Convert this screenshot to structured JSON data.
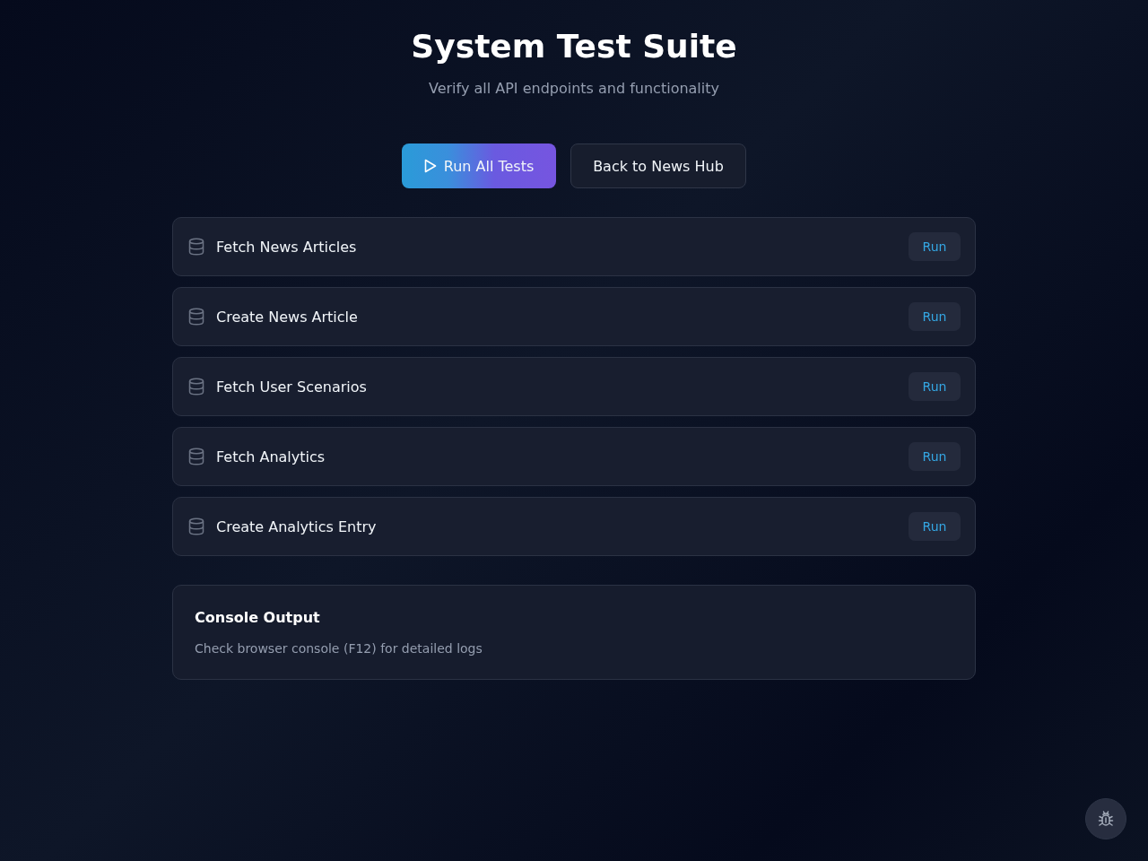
{
  "header": {
    "title": "System Test Suite",
    "subtitle": "Verify all API endpoints and functionality"
  },
  "actions": [
    {
      "kind": "primary",
      "label": "Run All Tests"
    },
    {
      "kind": "secondary",
      "label": "Back to News Hub"
    }
  ],
  "tests": [
    {
      "name": "Fetch News Articles",
      "button": "Run"
    },
    {
      "name": "Create News Article",
      "button": "Run"
    },
    {
      "name": "Fetch User Scenarios",
      "button": "Run"
    },
    {
      "name": "Fetch Analytics",
      "button": "Run"
    },
    {
      "name": "Create Analytics Entry",
      "button": "Run"
    }
  ],
  "console": {
    "title": "Console Output",
    "text": "Check browser console (F12) for detailed logs"
  }
}
